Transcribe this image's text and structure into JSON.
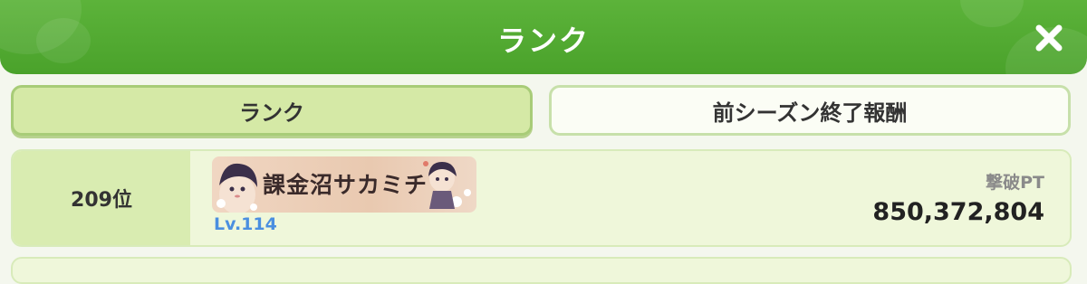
{
  "header": {
    "title": "ランク",
    "close_icon": "close-icon"
  },
  "tabs": [
    {
      "label": "ランク",
      "active": true
    },
    {
      "label": "前シーズン終了報酬",
      "active": false
    }
  ],
  "entries": [
    {
      "rank": "209位",
      "player_name": "課金沼サカミチ",
      "level": "Lv.114",
      "score_label": "撃破PT",
      "score": "850,372,804"
    }
  ],
  "colors": {
    "header_green": "#4aa22b",
    "active_tab": "#d5e9a6",
    "level_blue": "#4a8fe0"
  }
}
